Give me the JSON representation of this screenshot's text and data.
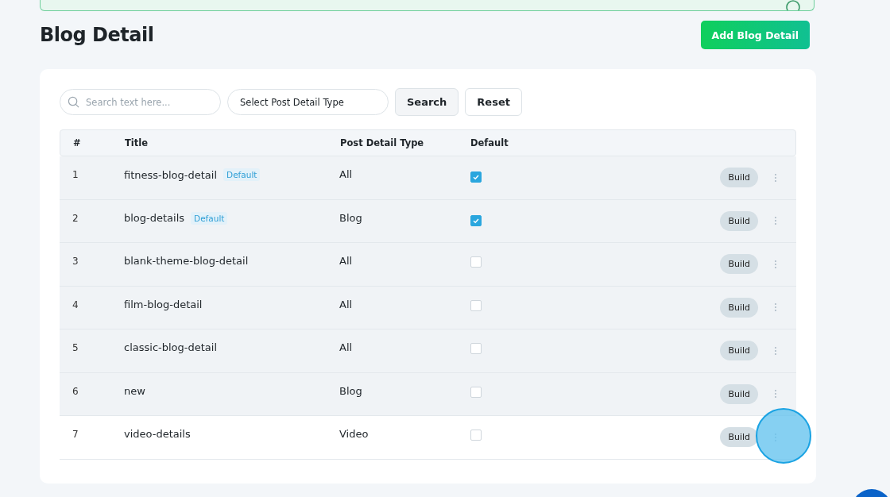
{
  "page": {
    "title": "Blog Detail",
    "add_button": "Add Blog Detail"
  },
  "filters": {
    "search_placeholder": "Search text here...",
    "select_value": "Select Post Detail Type",
    "search_button": "Search",
    "reset_button": "Reset"
  },
  "table": {
    "columns": [
      "#",
      "Title",
      "Post Detail Type",
      "Default"
    ],
    "rows": [
      {
        "index": "1",
        "title": "fitness-blog-detail",
        "badge": "Default",
        "type": "All",
        "checked": true,
        "shaded": true,
        "action": "Build"
      },
      {
        "index": "2",
        "title": "blog-details",
        "badge": "Default",
        "type": "Blog",
        "checked": true,
        "shaded": true,
        "action": "Build"
      },
      {
        "index": "3",
        "title": "blank-theme-blog-detail",
        "type": "All",
        "checked": false,
        "shaded": true,
        "action": "Build"
      },
      {
        "index": "4",
        "title": "film-blog-detail",
        "type": "All",
        "checked": false,
        "shaded": true,
        "action": "Build"
      },
      {
        "index": "5",
        "title": "classic-blog-detail",
        "type": "All",
        "checked": false,
        "shaded": true,
        "action": "Build"
      },
      {
        "index": "6",
        "title": "new",
        "type": "Blog",
        "checked": false,
        "shaded": true,
        "action": "Build"
      },
      {
        "index": "7",
        "title": "video-details",
        "type": "Video",
        "checked": false,
        "shaded": false,
        "action": "Build"
      }
    ]
  }
}
